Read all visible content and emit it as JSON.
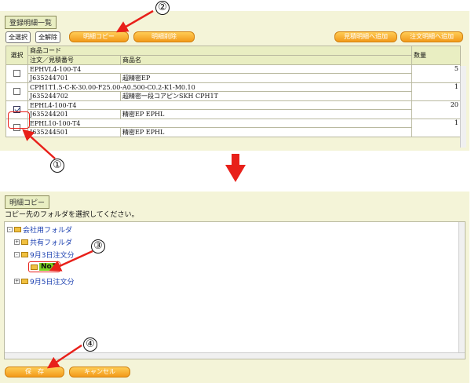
{
  "top_section": {
    "title": "登録明細一覧",
    "select_all_label": "全選択",
    "deselect_all_label": "全解除",
    "detail_copy_label": "明細コピー",
    "detail_delete_label": "明細削除",
    "add_to_estimate_label": "見積明細へ追加",
    "add_to_order_label": "注文明細へ追加",
    "columns": {
      "select": "選択",
      "product_code": "商品コード",
      "order_number": "注文／見積番号",
      "product_name": "商品名",
      "quantity": "数量"
    },
    "rows": [
      {
        "code": "EPHVL4-100-T4",
        "order_no": "J635244701",
        "name": "超精密EP",
        "qty": "5",
        "checked": false
      },
      {
        "code": "CPH1T1.5-C-K-30.00-F25.00-A0.500-C0.2-K1-M0.10",
        "order_no": "J635244702",
        "name": "超精密一段コアピンSKH CPH1T",
        "qty": "1",
        "checked": false
      },
      {
        "code": "EPHL4-100-T4",
        "order_no": "J635244201",
        "name": "精密EP EPHL",
        "qty": "20",
        "checked": true
      },
      {
        "code": "EPHL10-100-T4",
        "order_no": "J635244501",
        "name": "精密EP EPHL",
        "qty": "1",
        "checked": false
      }
    ]
  },
  "bottom_section": {
    "title": "明細コピー",
    "instruction": "コピー先のフォルダを選択してください。",
    "tree": {
      "root": "会社用フォルダ",
      "shared": "共有フォルダ",
      "sep3": "9月3日注文分",
      "selected": "No1",
      "sep5": "9月5日注文分"
    },
    "save_label": "保　存",
    "cancel_label": "キャンセル"
  },
  "callouts": {
    "c1": "①",
    "c2": "②",
    "c3": "③",
    "c4": "④"
  },
  "colors": {
    "accent_orange": "#f39a1a",
    "panel_bg": "#f4f4d8",
    "arrow_red": "#e8201a",
    "selected_green": "#7ed321"
  }
}
